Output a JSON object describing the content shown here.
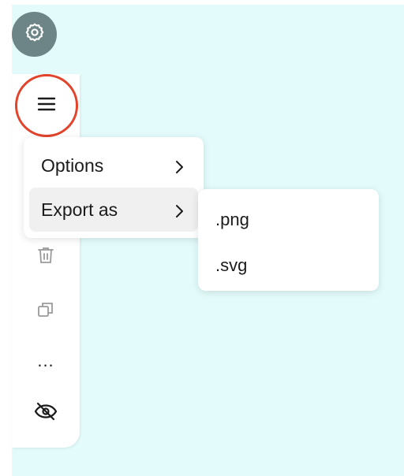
{
  "toolbar": {
    "icons": [
      "gear-icon",
      "hamburger-menu-icon",
      "trash-icon",
      "duplicate-icon",
      "more-options-icon",
      "eye-off-icon"
    ],
    "more_label": "..."
  },
  "menu": {
    "items": [
      {
        "label": "Options",
        "icon": "chevron-right-icon"
      },
      {
        "label": "Export as",
        "icon": "chevron-right-icon"
      }
    ]
  },
  "export_submenu": {
    "items": [
      {
        "label": ".png"
      },
      {
        "label": ".svg"
      }
    ]
  },
  "colors": {
    "canvas": "#e3fbfb",
    "settings_button": "#6e8587",
    "highlight_ring": "#e2432a",
    "active_item": "#f0f0f0"
  }
}
